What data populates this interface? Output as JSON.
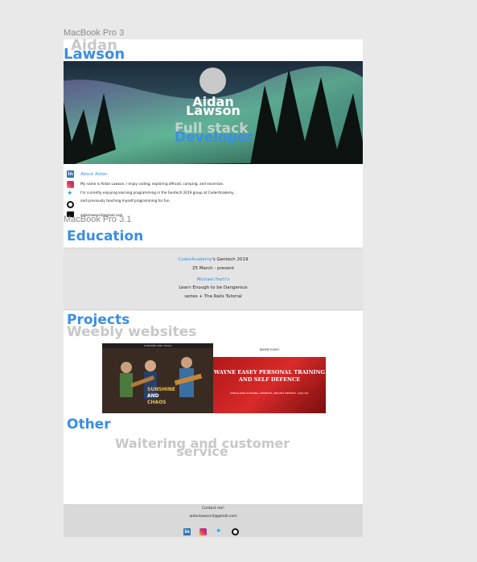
{
  "frames": {
    "frame1_label": "MacBook Pro 3",
    "frame2_label": "MacBook Pro 3.1"
  },
  "logo": {
    "first": "Aidan",
    "last": "Lawson"
  },
  "hero": {
    "name_first": "Aidan",
    "name_last": "Lawson",
    "role_line1": "Full stack",
    "role_line2": "Developer"
  },
  "about": {
    "title": "About Aidan",
    "lines": [
      "My name is Aidan Lawson, I enjoy coding, exploring offroad, camping, and excersize.",
      "I'm currently enjoying learning programming in the Gentech 2019 group at CoderAcademy,",
      "and previously teaching myself programming for fun."
    ],
    "email": "aidanlawson3@gmail.com"
  },
  "icons": [
    "linkedin-icon",
    "instagram-icon",
    "twitter-icon",
    "github-icon",
    "email-icon"
  ],
  "education": {
    "title": "Education",
    "org_link": "CoderAcademy",
    "org_rest": "'s Gentech 2019",
    "dates": "25 March - present",
    "author_link": "Michael Hartl's",
    "book_line1": "Learn Enough to be Dangerous",
    "book_line2": "series + The Rails Tutorial"
  },
  "projects": {
    "title": "Projects",
    "subtitle": "Weebly websites",
    "site1": {
      "nav": "SUNSHINE AND CHAOS",
      "word1": "SUNSHINE",
      "word2": "AND",
      "word3": "CHAOS"
    },
    "site2": {
      "header": "WAYNE EASEY",
      "title": "WAYNE EASEY PERSONAL TRAINING AND SELF DEFENCE",
      "subtitle": "SPECIALISING IN BOXING, STRENGTH, AND SELF DEFENCE · 0424 991"
    }
  },
  "other": {
    "title": "Other",
    "subtitle": "Waitering and customer service"
  },
  "footer": {
    "contact": "Contact me!",
    "email": "aidanlawson3@gmail.com"
  }
}
